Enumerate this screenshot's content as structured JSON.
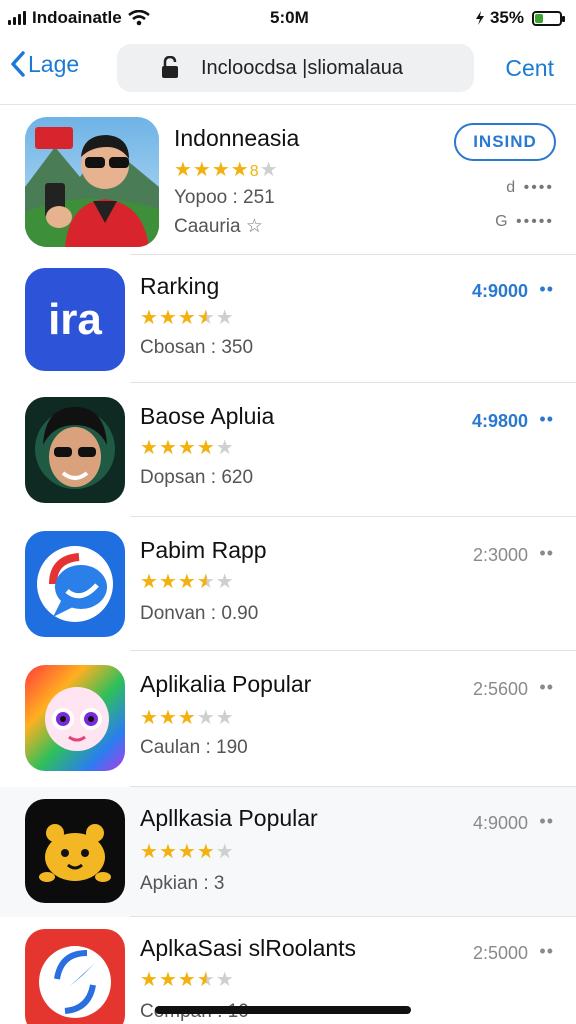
{
  "status": {
    "carrier": "Indoainatle",
    "time": "5:0M",
    "battery_text": "35%",
    "battery_level_pct": 35
  },
  "nav": {
    "back_label": "Lage",
    "search_text": "Incloocdsa |sliomalaua",
    "right_label": "Cent"
  },
  "featured": {
    "title": "Indonneasia",
    "rating_stars": 4,
    "stars_text": "8",
    "meta1": "Yopoo : 251",
    "meta2": "Caauria",
    "meta2_icon": "star-outline-icon",
    "get_label": "INSIND",
    "side1": "d ••••",
    "side2": "G •••••"
  },
  "apps": [
    {
      "title": "Rarking",
      "rating_stars": 3.5,
      "meta": "Cbosan : 350",
      "price": "4:9000",
      "price_style": "blue",
      "icon": "ira"
    },
    {
      "title": "Baose Apluia",
      "rating_stars": 4,
      "meta": "Dopsan : 620",
      "price": "4:9800",
      "price_style": "blue",
      "icon": "face"
    },
    {
      "title": "Pabim Rapp",
      "rating_stars": 3.5,
      "meta": "Donvan : 0.90",
      "price": "2:3000",
      "price_style": "gray",
      "icon": "chat"
    },
    {
      "title": "Aplikalia Popular",
      "rating_stars": 3,
      "meta": "Caulan : 190",
      "price": "2:5600",
      "price_style": "gray",
      "icon": "rainbow"
    },
    {
      "title": "Apllkasia Popular",
      "rating_stars": 4,
      "meta": "Apkian : 3",
      "price": "4:9000",
      "price_style": "gray",
      "icon": "bear"
    },
    {
      "title": "AplkaSasi slRoolants",
      "rating_stars": 3.5,
      "meta": "Compan : 10",
      "price": "2:5000",
      "price_style": "gray",
      "icon": "compass"
    }
  ],
  "colors": {
    "accent": "#1a7ad6",
    "star": "#f2b10e",
    "battery": "#3aa52e"
  }
}
